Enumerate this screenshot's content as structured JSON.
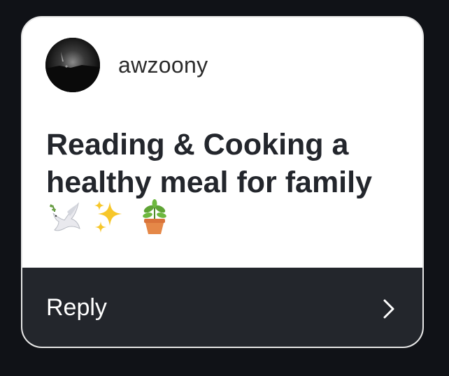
{
  "card": {
    "username": "awzoony",
    "avatar_icon": "night-landscape-avatar",
    "message": "Reading & Cooking a healthy meal for family",
    "emojis": [
      "dove-emoji",
      "sparkles-emoji",
      "potted-plant-emoji"
    ],
    "reply_label": "Reply"
  },
  "colors": {
    "background": "#101217",
    "card": "#ffffff",
    "reply_bar": "#23262c",
    "text_dark": "#23262c"
  }
}
